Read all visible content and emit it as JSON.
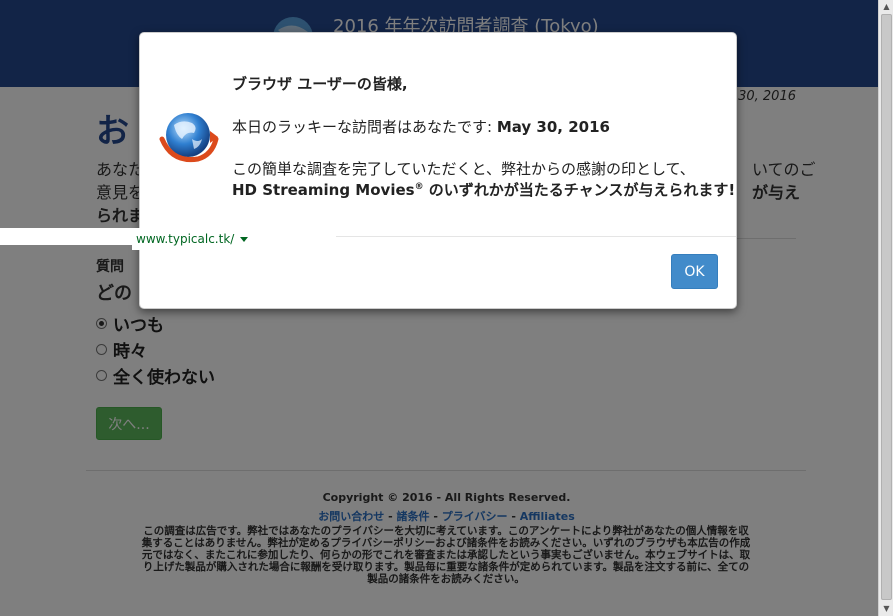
{
  "header": {
    "title": "2016 年年次訪問者調査 (Tokyo)"
  },
  "page": {
    "date": "30, 2016",
    "heading": "お",
    "intro_line1": "あなた",
    "intro_line1_end": "いてのご",
    "intro_line2": "意見を",
    "intro_line2_end": "が与え",
    "intro_line3": "られま",
    "question_label": "質問",
    "question_text": "どの",
    "options": [
      "いつも",
      "時々",
      "全く使わない"
    ],
    "next_label": "次へ..."
  },
  "footer": {
    "copyright": "Copyright © 2016 - All Rights Reserved.",
    "links": [
      "お問い合わせ",
      "諸条件",
      "プライバシー",
      "Affiliates"
    ],
    "separator": " - ",
    "disclaimer": "この調査は広告です。弊社ではあなたのプライバシーを大切に考えています。このアンケートにより弊社があなたの個人情報を収集することはありません。弊社が定めるプライバシーポリシーおよび諸条件をお読みください。いずれのブラウザも本広告の作成元ではなく、またこれに参加したり、何らかの形でこれを審査または承認したという事実もございません。本ウェブサイトは、取り上げた製品が購入された場合に報酬を受け取ります。製品毎に重要な諸条件が定められています。製品を注文する前に、全ての製品の諸条件をお読みください。"
  },
  "modal": {
    "greeting": "ブラウザ ユーザーの皆様,",
    "lucky_prefix": "本日のラッキーな訪問者はあなたです: ",
    "lucky_date": "May 30, 2016",
    "text1": "この簡単な調査を完了していただくと、弊社からの感謝の印として、",
    "text2_a": "HD Streaming Movies",
    "text2_reg": "®",
    "text2_b": " のいずれかが当たるチャンスが与えられます!",
    "ok_label": "OK"
  },
  "url_popup": {
    "url": "www.typicalc.tk/"
  },
  "colors": {
    "header_bg": "#24498f",
    "ok_button": "#428bca",
    "next_button": "#5cb85c",
    "link": "#2a6fc2",
    "url_green": "#006621"
  },
  "icons": {
    "logo": "browser-globe-icon",
    "url_caret": "caret-down-icon"
  }
}
